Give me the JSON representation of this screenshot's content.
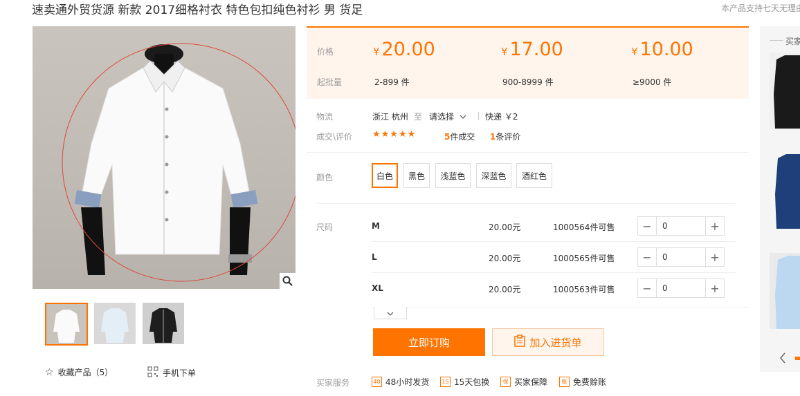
{
  "product": {
    "title": "速卖通外贸货源 新款 2017细格衬衣 特色包扣纯色衬衫 男 货足",
    "notice": "本产品支持七天无理由"
  },
  "gallery": {
    "zoom_icon": "magnifier-icon",
    "thumbnails": [
      {
        "name": "white-shirt",
        "color": "#f2f2f2"
      },
      {
        "name": "light-blue-shirt",
        "color": "#dde8f2"
      },
      {
        "name": "black-shirt",
        "color": "#222222"
      }
    ],
    "favorite_label": "收藏产品（5）",
    "mobile_label": "手机下单"
  },
  "pricing": {
    "price_label": "价格",
    "moq_label": "起批量",
    "currency": "¥",
    "tiers": [
      {
        "price": "20.00",
        "range": "2-899 件"
      },
      {
        "price": "17.00",
        "range": "900-8999 件"
      },
      {
        "price": "10.00",
        "range": "≥9000 件"
      }
    ]
  },
  "logistics": {
    "label": "物流",
    "from": "浙江 杭州",
    "to_word": "至",
    "dest_select": "请选择",
    "express": "快递 ￥2"
  },
  "reviews": {
    "label": "成交\\评价",
    "stars": "★★★★★",
    "deals_count": "5",
    "deals_suffix": "件成交",
    "review_count": "1",
    "review_suffix": "条评价"
  },
  "colors": {
    "label": "颜色",
    "options": [
      "白色",
      "黑色",
      "浅蓝色",
      "深蓝色",
      "酒红色"
    ],
    "selected": "白色"
  },
  "sizes": {
    "label": "尺码",
    "rows": [
      {
        "size": "M",
        "price": "20.00元",
        "stock": "1000564件可售",
        "qty": "0"
      },
      {
        "size": "L",
        "price": "20.00元",
        "stock": "1000565件可售",
        "qty": "0"
      },
      {
        "size": "XL",
        "price": "20.00元",
        "stock": "1000563件可售",
        "qty": "0"
      }
    ]
  },
  "actions": {
    "order_label": "立即订购",
    "cart_label": "加入进货单"
  },
  "services": {
    "label": "买家服务",
    "items": [
      {
        "icon": "48",
        "text": "48小时发货"
      },
      {
        "icon": "15",
        "text": "15天包换"
      },
      {
        "icon": "保",
        "text": "买家保障"
      },
      {
        "icon": "账",
        "text": "免费赊账"
      }
    ]
  },
  "sidebar": {
    "title": "买家"
  },
  "colors_theme": {
    "accent": "#ff7300",
    "price_bg": "#fff5ec"
  }
}
